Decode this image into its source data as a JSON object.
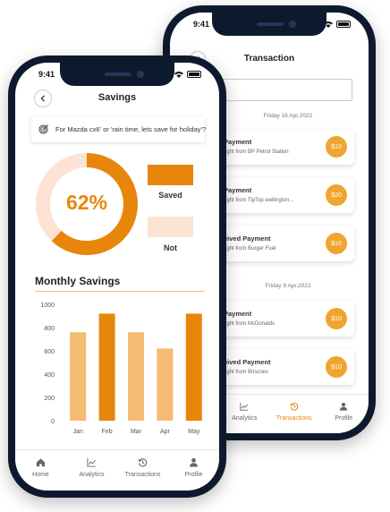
{
  "colors": {
    "accent": "#e8860c",
    "accent_light": "#f5bb73",
    "donut_remaining": "#fde3d3",
    "amount_badge": "#f0a531",
    "phone_frame": "#0d1a2e"
  },
  "transactions_screen": {
    "status_time": "9:41",
    "title": "Transaction",
    "search_placeholder": "h",
    "groups": [
      {
        "date": "Friday 16 Apr,2022",
        "items": [
          {
            "title": "Payment",
            "subtitle": "ught from BP Petrol Station",
            "amount": "$10"
          },
          {
            "title": "Payment",
            "subtitle": "ught from TipTop wellington...",
            "amount": "$20"
          },
          {
            "title": "eived Payment",
            "subtitle": "ught from Burger Fuel",
            "amount": "$10"
          }
        ]
      },
      {
        "date": "Friday 9 Apr,2022",
        "items": [
          {
            "title": "Payment",
            "subtitle": "ught from McDonalds",
            "amount": "$10"
          },
          {
            "title": "eived Payment",
            "subtitle": "ught from Briscoes",
            "amount": "$10"
          }
        ]
      }
    ],
    "nav": [
      {
        "label": "",
        "icon": "home-icon",
        "active": false
      },
      {
        "label": "Analytics",
        "icon": "analytics-icon",
        "active": false
      },
      {
        "label": "Transactions",
        "icon": "transactions-icon",
        "active": true
      },
      {
        "label": "Profile",
        "icon": "profile-icon",
        "active": false
      }
    ]
  },
  "savings_screen": {
    "status_time": "9:41",
    "title": "Savings",
    "goal_text": "For Mazda cx6' or 'rain time, lets save for holiday'?",
    "goal_icon": "target-icon",
    "progress": {
      "percent_label": "62%",
      "fraction": 0.62
    },
    "legend": {
      "saved": "Saved",
      "not": "Not"
    },
    "section_title": "Monthly Savings",
    "nav": [
      {
        "label": "Home",
        "icon": "home-icon",
        "active": false
      },
      {
        "label": "Analytics",
        "icon": "analytics-icon",
        "active": false
      },
      {
        "label": "Transactions",
        "icon": "transactions-icon",
        "active": false
      },
      {
        "label": "Profile",
        "icon": "profile-icon",
        "active": false
      }
    ]
  },
  "chart_data": {
    "type": "bar",
    "title": "Monthly Savings",
    "categories": [
      "Jan",
      "Feb",
      "Mar",
      "Apr",
      "May"
    ],
    "values": [
      760,
      920,
      760,
      620,
      920
    ],
    "bar_colors": [
      "#f5bb73",
      "#e8860c",
      "#f5bb73",
      "#f5bb73",
      "#e8860c"
    ],
    "yticks": [
      0,
      200,
      400,
      600,
      800,
      1000
    ],
    "ylim": [
      0,
      1000
    ],
    "xlabel": "",
    "ylabel": "",
    "grid": false,
    "legend": "none"
  }
}
